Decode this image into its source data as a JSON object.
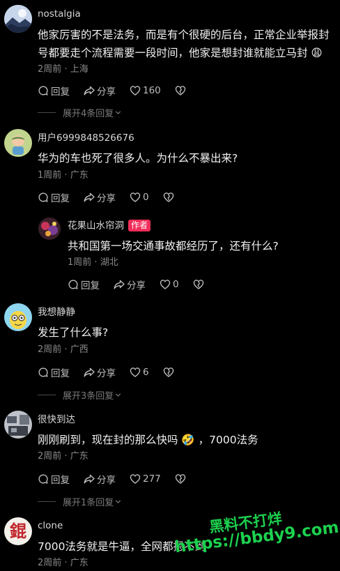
{
  "comments": [
    {
      "username": "nostalgia",
      "text_lines": [
        "他家厉害的不是法务，而是有个很硬的后台，正常企业举报封",
        "号都要走个流程需要一段时间，他家是想封谁就能立马封 😩"
      ],
      "time": "2周前",
      "location": "上海",
      "reply_label": "回复",
      "share_label": "分享",
      "likes": "160",
      "expand_label": "展开4条回复"
    },
    {
      "username": "用户6999848526676",
      "text": "华为的车也死了很多人。为什么不暴出来?",
      "time": "1周前",
      "location": "广东",
      "reply_label": "回复",
      "share_label": "分享",
      "likes": "0"
    },
    {
      "username": "花果山水帘洞",
      "author_tag": "作者",
      "text": "共和国第一场交通事故都经历了，还有什么?",
      "time": "1周前",
      "location": "湖北",
      "reply_label": "回复",
      "share_label": "分享",
      "likes": "0"
    },
    {
      "username": "我想静静",
      "text": "发生了什么事?",
      "time": "2周前",
      "location": "广西",
      "reply_label": "回复",
      "share_label": "分享",
      "likes": "6",
      "expand_label": "展开3条回复"
    },
    {
      "username": "很快到达",
      "text": "刚刚刷到，现在封的那么快吗 🤣 ，7000法务",
      "time": "2周前",
      "location": "广东",
      "reply_label": "回复",
      "share_label": "分享",
      "likes": "277",
      "expand_label": "展开1条回复"
    },
    {
      "username": "clone",
      "text": "7000法务就是牛逼，全网都摁不到",
      "time": "2周前",
      "location": "广东"
    }
  ],
  "avatar_glyph_clone": "錕",
  "watermark": {
    "line1": "黑料不打烊",
    "line2": "https://bbdy9.com"
  },
  "colors": {
    "background": "#000000",
    "author_tag": "#f02e5a",
    "watermark": "#1cd14e"
  }
}
